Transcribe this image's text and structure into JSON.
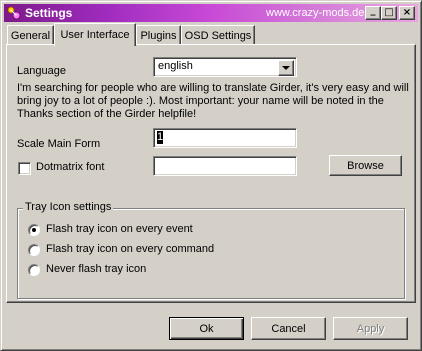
{
  "window": {
    "title": "Settings",
    "url": "www.crazy-mods.de",
    "controls": {
      "minimize": "_",
      "maximize": "□",
      "close": "×"
    }
  },
  "tabs": [
    {
      "label": "General",
      "active": false
    },
    {
      "label": "User Interface",
      "active": true
    },
    {
      "label": "Plugins",
      "active": false
    },
    {
      "label": "OSD Settings",
      "active": false
    }
  ],
  "ui": {
    "language_label": "Language",
    "language_value": "english",
    "description": "I'm searching for people who are willing to translate Girder, it's very easy and will bring joy to a lot of people :). Most important: your name will be noted in the Thanks section of the Girder helpfile!",
    "scale_label": "Scale Main Form",
    "scale_value": "1",
    "dotmatrix_label": "Dotmatrix font",
    "dotmatrix_checked": false,
    "dotmatrix_value": "",
    "browse_label": "Browse"
  },
  "tray": {
    "group_label": "Tray Icon settings",
    "options": [
      {
        "label": "Flash tray icon on every event",
        "selected": true
      },
      {
        "label": "Flash tray icon on every command",
        "selected": false
      },
      {
        "label": "Never flash tray icon",
        "selected": false
      }
    ]
  },
  "footer": {
    "ok_label": "Ok",
    "cancel_label": "Cancel",
    "apply_label": "Apply"
  },
  "colors": {
    "title_gradient_start": "#7d1a8a",
    "title_gradient_end": "#e8a6e0",
    "face": "#d4d0c8"
  },
  "icons": {
    "app": "app-icon",
    "combo": "chevron-down-icon"
  }
}
